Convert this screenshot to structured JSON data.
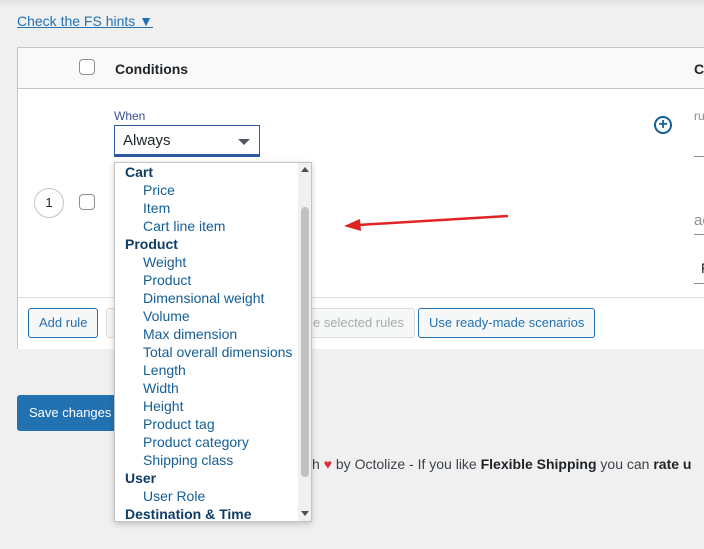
{
  "hint_link": "Check the FS hints ▼",
  "table": {
    "header": {
      "conditions": "Conditions",
      "next_col": "Co"
    },
    "row": {
      "number": "1",
      "when_label": "When",
      "when_value": "Always",
      "right_label_1": "ru",
      "right_value_1": "(",
      "right_label_2": "ac",
      "right_value_2": "F"
    },
    "footer": {
      "add_rule": "Add rule",
      "delete_selected": "e selected rules",
      "use_scenarios": "Use ready-made scenarios"
    }
  },
  "dropdown": {
    "items": [
      {
        "label": "Cart",
        "group": true
      },
      {
        "label": "Price"
      },
      {
        "label": "Item"
      },
      {
        "label": "Cart line item"
      },
      {
        "label": "Product",
        "group": true
      },
      {
        "label": "Weight"
      },
      {
        "label": "Product"
      },
      {
        "label": "Dimensional weight"
      },
      {
        "label": "Volume"
      },
      {
        "label": "Max dimension"
      },
      {
        "label": "Total overall dimensions"
      },
      {
        "label": "Length"
      },
      {
        "label": "Width"
      },
      {
        "label": "Height"
      },
      {
        "label": "Product tag"
      },
      {
        "label": "Product category"
      },
      {
        "label": "Shipping class"
      },
      {
        "label": "User",
        "group": true
      },
      {
        "label": "User Role"
      },
      {
        "label": "Destination & Time",
        "group": true
      }
    ]
  },
  "save_changes": "Save changes",
  "footer": {
    "part1": "h",
    "heart": "♥",
    "part2": " by Octolize - If you like ",
    "brand": "Flexible Shipping",
    "part3": " you can ",
    "rate": "rate u"
  },
  "colors": {
    "accent": "#2271b1",
    "annotation_arrow": "#e02424",
    "heart": "#d63638"
  }
}
